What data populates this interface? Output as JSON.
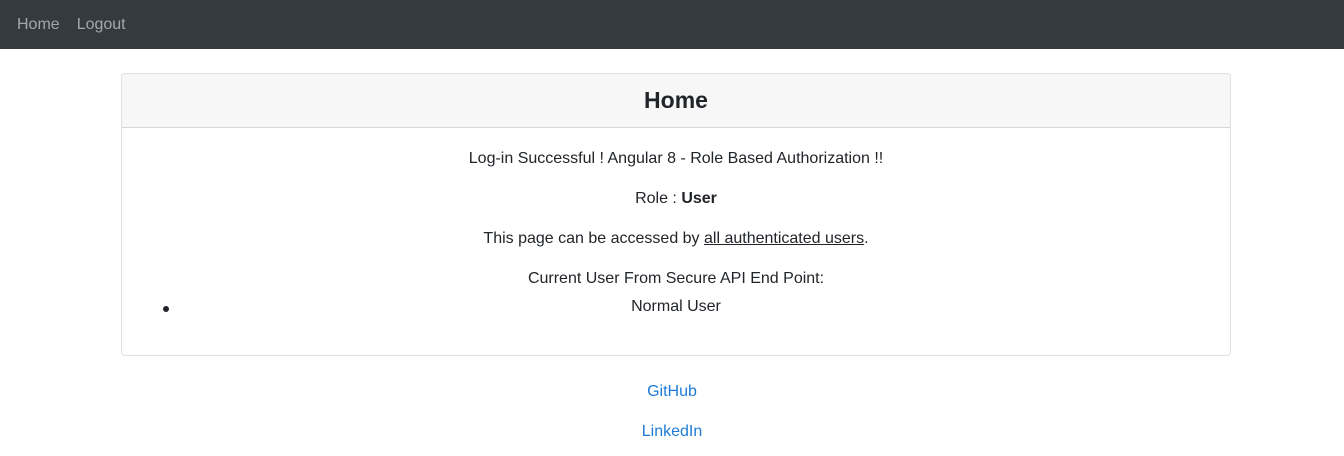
{
  "navbar": {
    "items": [
      {
        "label": "Home"
      },
      {
        "label": "Logout"
      }
    ]
  },
  "card": {
    "title": "Home",
    "message": "Log-in Successful ! Angular 8 - Role Based Authorization !!",
    "role_prefix": "Role : ",
    "role_value": "User",
    "access_prefix": "This page can be accessed by ",
    "access_link": "all authenticated users",
    "access_suffix": ".",
    "api_heading": "Current User From Secure API End Point:",
    "users": [
      "Normal User"
    ]
  },
  "footer": {
    "links": [
      {
        "label": "GitHub"
      },
      {
        "label": "LinkedIn"
      }
    ]
  }
}
